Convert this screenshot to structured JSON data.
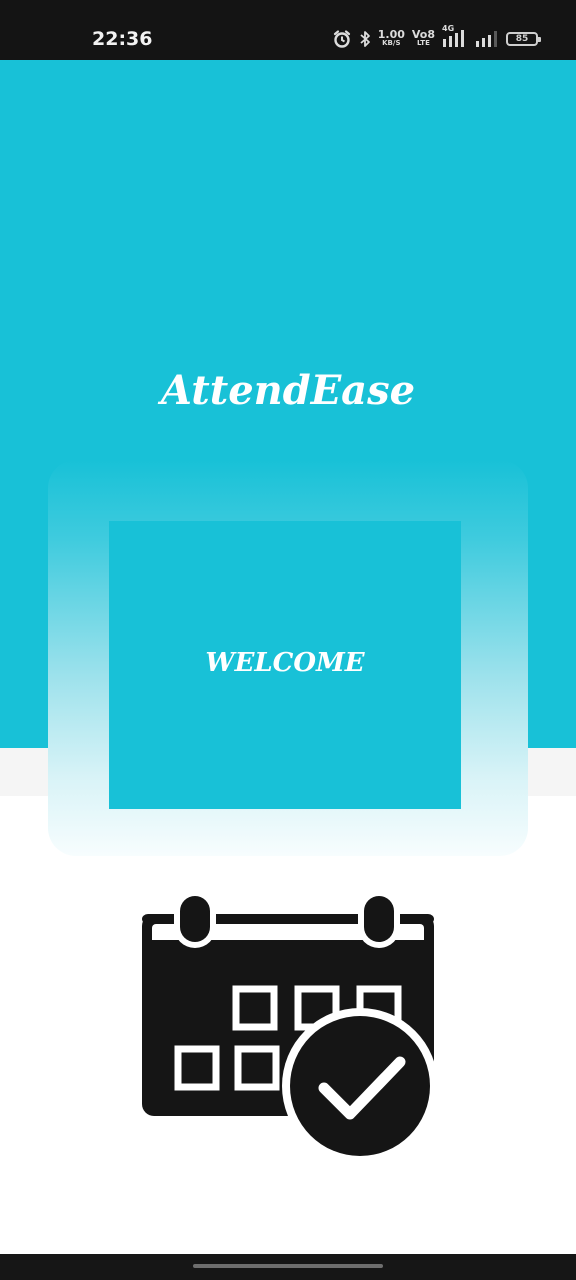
{
  "status_bar": {
    "time": "22:36",
    "network_speed": "1.00",
    "network_speed_unit": "KB/S",
    "volte_top": "Vo8",
    "volte_bottom": "LTE",
    "network_type": "4G",
    "battery_level": "85",
    "icons": [
      "alarm-icon",
      "bluetooth-icon",
      "signal-icon",
      "signal-icon",
      "battery-icon"
    ]
  },
  "hero": {
    "app_title": "AttendEase",
    "background_color": "#18c1d7"
  },
  "welcome_card": {
    "label": "WELCOME"
  },
  "illustration": {
    "icon": "calendar-check-icon"
  },
  "colors": {
    "accent": "#18c1d7",
    "status_bar": "#141414",
    "text_on_accent": "#ffffff"
  }
}
